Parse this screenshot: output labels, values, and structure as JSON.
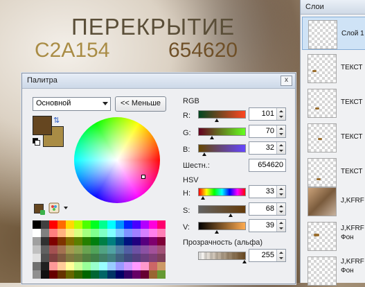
{
  "canvas": {
    "title_text": "ПЕРЕКРЫТИЕ",
    "color1_text": "C2A154",
    "color2_text": "654620"
  },
  "palette": {
    "window_title": "Палитра",
    "close_label": "x",
    "mode_select": "Основной",
    "less_button": "<< Меньше",
    "primary_color": "#654620",
    "secondary_color": "#a98c45",
    "rgb": {
      "label": "RGB",
      "r_label": "R:",
      "r_value": "101",
      "g_label": "G:",
      "g_value": "70",
      "b_label": "B:",
      "b_value": "32",
      "hex_label": "Шестн.:",
      "hex_value": "654620"
    },
    "hsv": {
      "label": "HSV",
      "h_label": "H:",
      "h_value": "33",
      "s_label": "S:",
      "s_value": "68",
      "v_label": "V:",
      "v_value": "39"
    },
    "alpha": {
      "label": "Прозрачность (альфа)",
      "value": "255"
    },
    "swatches": [
      "#000000",
      "#404040",
      "#ff0000",
      "#ff6a00",
      "#ffd800",
      "#b6ff00",
      "#4cff00",
      "#00ff21",
      "#00ff90",
      "#00ffff",
      "#0094ff",
      "#0026ff",
      "#4800ff",
      "#b200ff",
      "#ff00dc",
      "#ff006e",
      "#ffffff",
      "#808080",
      "#ff7f7f",
      "#ffb27f",
      "#ffe97f",
      "#daff7f",
      "#a5ff7f",
      "#7fff8e",
      "#7fffc5",
      "#7fffff",
      "#7fc9ff",
      "#7f92ff",
      "#a17fff",
      "#d67fff",
      "#ff7fed",
      "#ff7fb6",
      "#a0a0a0",
      "#303030",
      "#7f0000",
      "#7f3300",
      "#7f6a00",
      "#5b7f00",
      "#267f00",
      "#007f0e",
      "#007f46",
      "#007f7f",
      "#004a7f",
      "#00137f",
      "#21007f",
      "#57007f",
      "#7f006e",
      "#7f0037",
      "#c0c0c0",
      "#606060",
      "#a35151",
      "#a37151",
      "#a39a51",
      "#8da351",
      "#69a351",
      "#51a35a",
      "#51a383",
      "#51a3a3",
      "#517fa3",
      "#515ea3",
      "#6d51a3",
      "#8b51a3",
      "#a3519a",
      "#a35177",
      "#e0e0e0",
      "#505050",
      "#7f3f3f",
      "#7f593f",
      "#7f773f",
      "#6e7f3f",
      "#517f3f",
      "#3f7f47",
      "#3f7f66",
      "#3f7f7f",
      "#3f627f",
      "#3f4a7f",
      "#543f7f",
      "#6c3f7f",
      "#7f3f77",
      "#7f3f5b",
      "#707070",
      "#202020",
      "#ff9999",
      "#ffcc99",
      "#ffff99",
      "#ccff99",
      "#99ff99",
      "#99ffcc",
      "#99ffff",
      "#99ccff",
      "#9999ff",
      "#cc99ff",
      "#ff99ff",
      "#ff99cc",
      "#cc6666",
      "#cc9966",
      "#909090",
      "#101010",
      "#660000",
      "#663300",
      "#666600",
      "#336600",
      "#006600",
      "#006633",
      "#006666",
      "#003366",
      "#000066",
      "#330066",
      "#660066",
      "#660033",
      "#996633",
      "#669933"
    ]
  },
  "layers_panel": {
    "title": "Слои",
    "layers": [
      {
        "name": "Слой 1",
        "line2": ""
      },
      {
        "name": "ТЕКСТ",
        "line2": ""
      },
      {
        "name": "ТЕКСТ",
        "line2": ""
      },
      {
        "name": "ТЕКСТ",
        "line2": ""
      },
      {
        "name": "ТЕКСТ",
        "line2": ""
      },
      {
        "name": "J,KFRF",
        "line2": ""
      },
      {
        "name": "J,KFRF",
        "line2": "Фон"
      },
      {
        "name": "J,KFRF",
        "line2": "Фон"
      }
    ]
  }
}
